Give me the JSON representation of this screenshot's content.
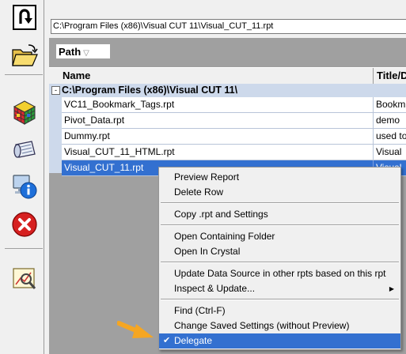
{
  "path_bar": "C:\\Program Files (x86)\\Visual CUT 11\\Visual_CUT_11.rpt",
  "group_by": {
    "label": "Path",
    "sort_indicator": "▽"
  },
  "columns": {
    "name": "Name",
    "title": "Title/D"
  },
  "group_row": {
    "expander": "-",
    "label": "C:\\Program Files (x86)\\Visual CUT 11\\"
  },
  "rows": [
    {
      "name": "VC11_Bookmark_Tags.rpt",
      "title": "Bookm"
    },
    {
      "name": "Pivot_Data.rpt",
      "title": "demo"
    },
    {
      "name": "Dummy.rpt",
      "title": "used to"
    },
    {
      "name": "Visual_CUT_11_HTML.rpt",
      "title": "Visual"
    },
    {
      "name": "Visual_CUT_11.rpt",
      "title": "Visual",
      "selected": true
    }
  ],
  "context_menu": {
    "preview_report": "Preview Report",
    "delete_row": "Delete Row",
    "copy_rpt": "Copy .rpt and Settings",
    "open_folder": "Open Containing Folder",
    "open_crystal": "Open In Crystal",
    "update_ds": "Update Data Source in other rpts based on this rpt",
    "inspect_update": "Inspect & Update...",
    "find": "Find (Ctrl-F)",
    "change_saved": "Change Saved Settings (without Preview)",
    "delegate": "Delegate",
    "delegate_check": "✔",
    "submenu_arrow": "▶"
  },
  "toolbar_icons": [
    "back-arrow-icon",
    "open-folder-icon",
    "rubiks-cube-icon",
    "scroll-icon",
    "info-icon",
    "close-icon",
    "chart-magnifier-icon"
  ],
  "colors": {
    "selection": "#3370d0",
    "group_row": "#cdd9eb",
    "arrow": "#f5a623"
  }
}
